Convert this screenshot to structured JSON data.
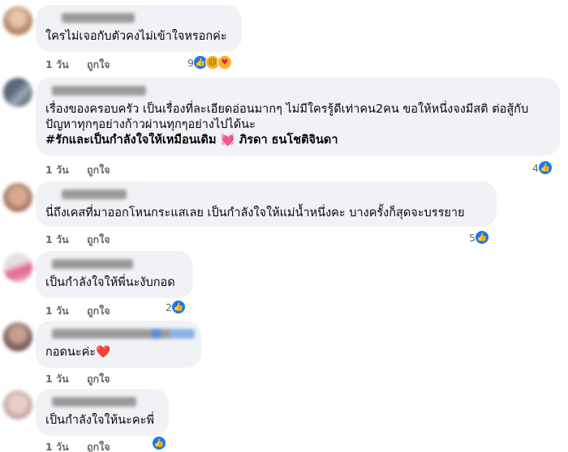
{
  "comments": [
    {
      "text_lines": [
        "ใครไม่เจอกับตัวคงไม่เข้าใจหรอกค่ะ"
      ],
      "time": "1 วัน",
      "like_label": "ถูกใจ",
      "reaction_count": "9",
      "reaction_icons": [
        "like-icon",
        "sad-icon",
        "care-icon"
      ]
    },
    {
      "text_lines": [
        "เรื่องของครอบครัว เป็นเรื่องที่ละเอียดอ่อนมากๆ ไม่มีใครรู้ดีเท่าคน2คน ขอให้หนึ่งจงมีสติ ต่อสู้กับ",
        "ปัญหาทุกๆอย่างก้าวผ่านทุกๆอย่างไปได้นะ"
      ],
      "hashtag_line": "#รักและเป็นกำลังใจให้เหมือนเดิม",
      "heart_emoji": "💓",
      "hashtag_suffix": "ภิรดา ธนโชติจินดา",
      "time": "1 วัน",
      "like_label": "ถูกใจ",
      "reaction_count": "4",
      "reaction_icons": [
        "like-icon"
      ]
    },
    {
      "text_lines": [
        "นี่ถึงเคสที่มาออกโหนกระแสเลย เป็นกำลังใจให้แม่น้ำหนึ่งคะ บางครั้งก็สุดจะบรรยาย"
      ],
      "time": "1 วัน",
      "like_label": "ถูกใจ",
      "reaction_count": "5",
      "reaction_icons": [
        "like-icon"
      ]
    },
    {
      "text_lines": [
        "เป็นกำลังใจให้พี่นะงับกอด"
      ],
      "time": "1 วัน",
      "like_label": "ถูกใจ",
      "reaction_count": "2",
      "reaction_icons": [
        "like-icon"
      ]
    },
    {
      "text_lines": [
        "กอดนะค่ะ❤️"
      ],
      "time": "1 วัน",
      "like_label": "ถูกใจ",
      "reaction_count": "",
      "reaction_icons": []
    },
    {
      "text_lines": [
        "เป็นกำลังใจให้นะคะพี่"
      ],
      "time": "1 วัน",
      "like_label": "ถูกใจ",
      "reaction_count": "",
      "reaction_icons": [
        "like-icon"
      ]
    }
  ],
  "colors": {
    "bubble": "#f0f2f5",
    "meta_text": "#65676b",
    "like_blue": "#1877f2"
  }
}
